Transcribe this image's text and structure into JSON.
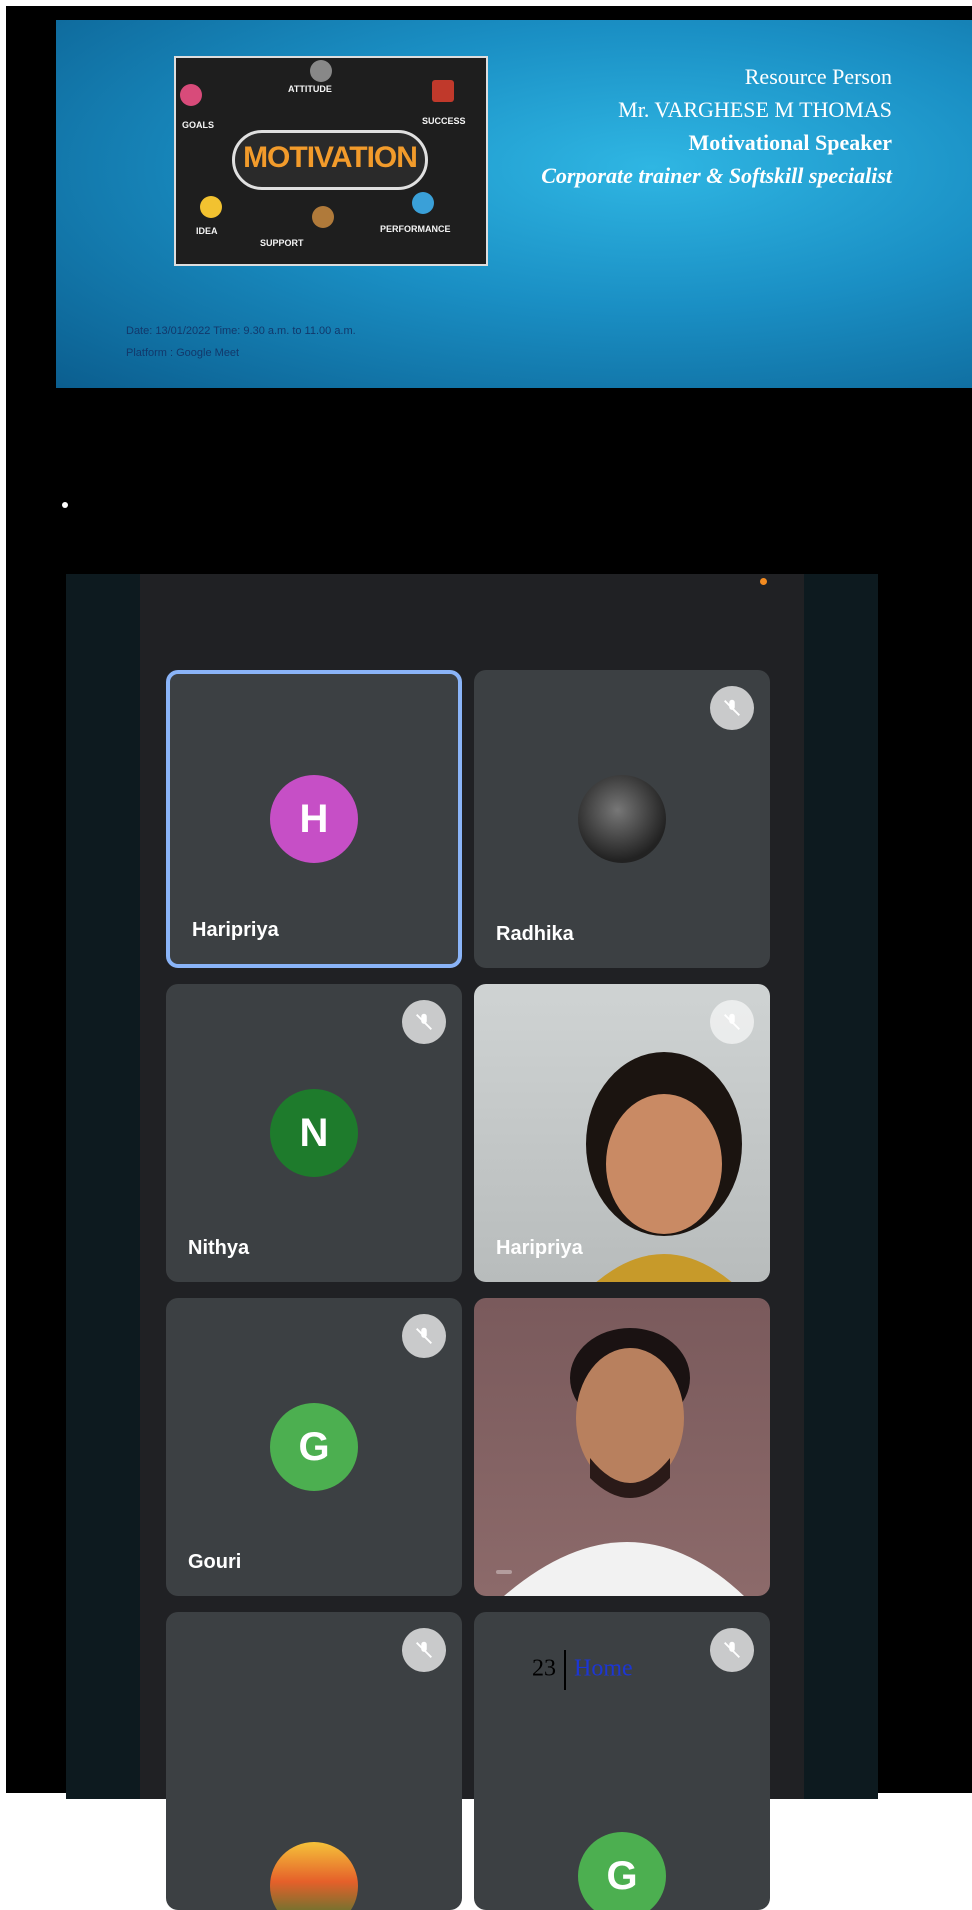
{
  "banner": {
    "poster": {
      "center_word": "MOTIVATION",
      "tags": [
        "ATTITUDE",
        "GOALS",
        "SUCCESS",
        "IDEA",
        "SUPPORT",
        "PERFORMANCE"
      ]
    },
    "resource_person": {
      "line1": "Resource Person",
      "line2": "Mr. VARGHESE M THOMAS",
      "line3": "Motivational Speaker",
      "line4": "Corporate trainer & Softskill specialist"
    },
    "meta": {
      "date_line": "Date: 13/01/2022 Time: 9.30 a.m. to 11.00 a.m.",
      "platform_line": "Platform : Google Meet"
    }
  },
  "meet": {
    "tiles": [
      {
        "name": "Haripriya",
        "initial": "H",
        "avatar_color": "#c64fc6",
        "active": true,
        "muted": false
      },
      {
        "name": "Radhika",
        "initial": "",
        "avatar_color": "#222222",
        "active": false,
        "muted": true
      },
      {
        "name": "Nithya",
        "initial": "N",
        "avatar_color": "#1e7b2c",
        "active": false,
        "muted": true
      },
      {
        "name": "Haripriya",
        "initial": "",
        "avatar_color": "",
        "active": false,
        "muted": true,
        "video": true
      },
      {
        "name": "Gouri",
        "initial": "G",
        "avatar_color": "#4caf50",
        "active": false,
        "muted": true
      },
      {
        "name": "",
        "initial": "",
        "avatar_color": "",
        "active": false,
        "muted": false,
        "video": true
      },
      {
        "name": "",
        "initial": "",
        "avatar_color": "#e5602a",
        "active": false,
        "muted": true
      },
      {
        "name": "",
        "initial": "G",
        "avatar_color": "#4caf50",
        "active": false,
        "muted": true
      }
    ]
  },
  "footer": {
    "page_number": "23",
    "home_link": "Home"
  },
  "colors": {
    "active_border": "#8ab4f8",
    "tile_bg": "#3c4043",
    "meet_bg": "#202124"
  }
}
